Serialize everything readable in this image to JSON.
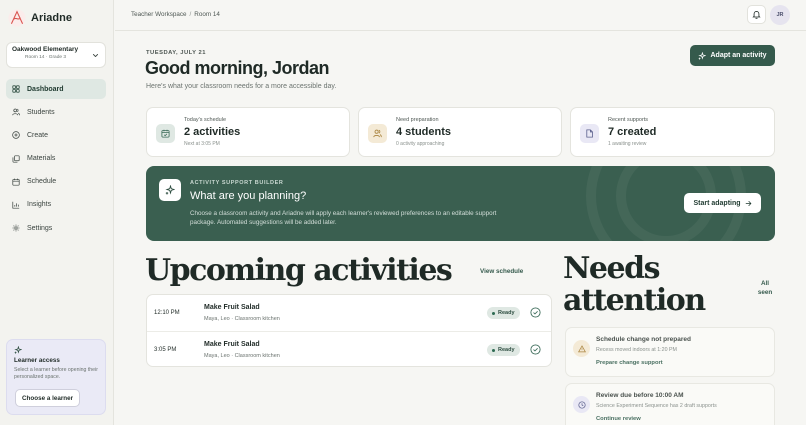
{
  "app": {
    "name": "Ariadne"
  },
  "school": {
    "name": "Oakwood Elementary",
    "room": "Room 14 · Grade 3"
  },
  "nav": [
    {
      "label": "Dashboard",
      "icon": "dashboard-icon",
      "active": true
    },
    {
      "label": "Students",
      "icon": "users-icon"
    },
    {
      "label": "Create",
      "icon": "plus-circle-icon"
    },
    {
      "label": "Materials",
      "icon": "copy-icon"
    },
    {
      "label": "Schedule",
      "icon": "calendar-icon"
    },
    {
      "label": "Insights",
      "icon": "bar-chart-icon"
    },
    {
      "label": "Settings",
      "icon": "gear-icon"
    }
  ],
  "learner": {
    "title": "Learner access",
    "description": "Select a learner before opening their personalized space.",
    "button": "Choose a learner"
  },
  "breadcrumb": {
    "workspace": "Teacher Workspace",
    "separator": "/",
    "room": "Room 14"
  },
  "user": {
    "initials": "JR"
  },
  "header": {
    "date": "TUESDAY, JULY 21",
    "greeting": "Good morning, Jordan",
    "subtitle": "Here's what your classroom needs for a more accessible day.",
    "adapt_button": "Adapt an activity"
  },
  "stats": [
    {
      "label": "Today's schedule",
      "value": "2 activities",
      "note": "Next at 3:05 PM",
      "icon": "calendar-check-icon",
      "color": "#dfe8e3",
      "stroke": "#3a6a58"
    },
    {
      "label": "Need preparation",
      "value": "4 students",
      "note": "0 activity approaching",
      "icon": "users-icon",
      "color": "#f4ead6",
      "stroke": "#a9833d"
    },
    {
      "label": "Recent supports",
      "value": "7 created",
      "note": "1 awaiting review",
      "icon": "document-icon",
      "color": "#e9e8f5",
      "stroke": "#5a5f8c"
    }
  ],
  "builder": {
    "eyebrow": "ACTIVITY SUPPORT BUILDER",
    "title": "What are you planning?",
    "description": "Choose a classroom activity and Ariadne will apply each learner's reviewed preferences to an editable support package. Automated suggestions will be added later.",
    "button": "Start adapting"
  },
  "upcoming": {
    "title": "Upcoming activities",
    "link": "View schedule",
    "rows": [
      {
        "time": "12:10 PM",
        "name": "Make Fruit Salad",
        "meta": "Maya, Leo · Classroom kitchen",
        "status": "Ready"
      },
      {
        "time": "3:05 PM",
        "name": "Make Fruit Salad",
        "meta": "Maya, Leo · Classroom kitchen",
        "status": "Ready"
      }
    ]
  },
  "attention": {
    "title": "Needs attention",
    "link": "All seen",
    "items": [
      {
        "title": "Schedule change not prepared",
        "desc": "Recess moved indoors at 1:20 PM",
        "link": "Prepare change support",
        "icon": "warning-icon",
        "color": "#f4ead6",
        "stroke": "#a9833d"
      },
      {
        "title": "Review due before 10:00 AM",
        "desc": "Science Experiment Sequence has 2 draft supports",
        "link": "Continue review",
        "icon": "clock-icon",
        "color": "#e9e8f5",
        "stroke": "#5a5f8c"
      }
    ]
  },
  "colors": {
    "accent": "#355a4c",
    "banner": "#3a5f50",
    "background": "#f6f6f3"
  }
}
